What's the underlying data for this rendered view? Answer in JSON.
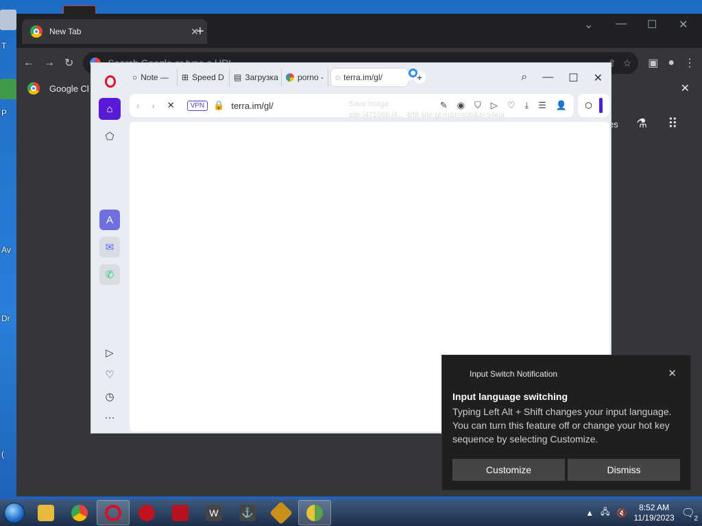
{
  "desktop": {
    "icon_labels": [
      "T",
      "P",
      "Av",
      "Dr",
      "("
    ]
  },
  "chrome": {
    "tab_title": "New Tab",
    "tab_close": "✕",
    "new_tab": "+",
    "omnibox_placeholder": "Search Google or type a URL",
    "bookmark_label": "Google Cl",
    "right_fragment": "es",
    "min": "—",
    "restore": "☐",
    "close": "✕",
    "collapse": "⌄"
  },
  "opera": {
    "tabs": [
      {
        "label": "Note —",
        "icon": "circle-icon"
      },
      {
        "label": "Speed D",
        "icon": "grid-icon"
      },
      {
        "label": "Загрузка",
        "icon": "download-page-icon"
      },
      {
        "label": "porno -",
        "icon": "google-icon"
      },
      {
        "label": "terra.im/gl/",
        "icon": "loading-icon",
        "active": true
      }
    ],
    "new_tab": "+",
    "address": "terra.im/gl/",
    "vpn_label": "VPN",
    "ghost_text": "Save image\nsite:i47106b.i4... 4rf8 site:gl.ru&t=s0b&a=s4kia\nSearch"
  },
  "notification": {
    "app_name": "Input Switch Notification",
    "title": "Input language switching",
    "body": "Typing Left Alt + Shift changes your input language. You can turn this feature off or change your hot key sequence by selecting Customize.",
    "customize_label": "Customize",
    "dismiss_label": "Dismiss",
    "close": "✕"
  },
  "taskbar": {
    "time": "8:52 AM",
    "date": "11/19/2023",
    "notif_count": "2",
    "apps": [
      {
        "name": "file-explorer",
        "color": "#e8b93b"
      },
      {
        "name": "chrome",
        "color": "#4285f4"
      },
      {
        "name": "opera",
        "color": "#d90d25"
      },
      {
        "name": "app-red-1",
        "color": "#c0121f"
      },
      {
        "name": "app-red-2",
        "color": "#b5121d"
      },
      {
        "name": "world-of-tanks",
        "color": "#444"
      },
      {
        "name": "world-of-warships",
        "color": "#444"
      },
      {
        "name": "app-gold",
        "color": "#c8901a"
      },
      {
        "name": "chrome-beta",
        "color": "#5aa34a"
      }
    ]
  }
}
